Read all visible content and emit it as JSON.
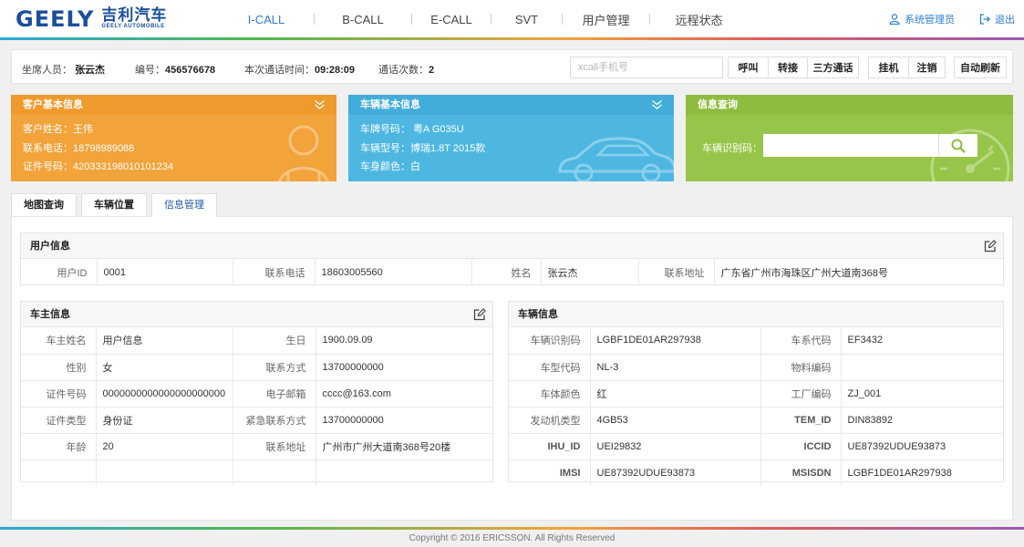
{
  "logo": {
    "brand": "GEELY",
    "cn": "吉利汽车",
    "sub": "GEELY AUTOMOBILE"
  },
  "nav": [
    "I-CALL",
    "B-CALL",
    "E-CALL",
    "SVT",
    "用户管理",
    "远程状态"
  ],
  "user": {
    "name": "系统管理员",
    "logout": "退出"
  },
  "infobar": {
    "agent_label": "坐席人员：",
    "agent": "张云杰",
    "id_label": "编号：",
    "id": "456576678",
    "time_label": "本次通话时间：",
    "time": "09:28:09",
    "count_label": "通话次数：",
    "count": "2",
    "xcall_placeholder": "xcall手机号",
    "buttons_a": [
      "呼叫",
      "转接",
      "三方通话"
    ],
    "buttons_b": [
      "挂机",
      "注销"
    ],
    "refresh": "自动刷新"
  },
  "customer": {
    "title": "客户基本信息",
    "name": "客户姓名：王伟",
    "phone": "联系电话：18798989088",
    "idno": "证件号码：420333198010101234"
  },
  "vehicle": {
    "title": "车辆基本信息",
    "plate": "车牌号码： 粤A G035U",
    "model": "车辆型号：博瑞1.8T 2015款",
    "color": "车身颜色：白"
  },
  "query": {
    "title": "信息查询",
    "vin_label": "车辆识别码："
  },
  "tabs": [
    "地图查询",
    "车辆位置",
    "信息管理"
  ],
  "user_info": {
    "title": "用户信息",
    "cells": [
      "用户ID",
      "0001",
      "联系电话",
      "18603005560",
      "姓名",
      "张云杰",
      "联系地址",
      "广东省广州市海珠区广州大道南368号"
    ]
  },
  "owner_info": {
    "title": "车主信息",
    "rows": [
      [
        "车主姓名",
        "用户信息",
        "生日",
        "1900.09.09"
      ],
      [
        "性别",
        "女",
        "联系方式",
        "13700000000"
      ],
      [
        "证件号码",
        "0000000000000000000000",
        "电子邮箱",
        "cccc@163.com"
      ],
      [
        "证件类型",
        "身份证",
        "紧急联系方式",
        "13700000000"
      ],
      [
        "年龄",
        "20",
        "联系地址",
        "广州市广州大道南368号20楼"
      ],
      [
        "",
        "",
        "",
        ""
      ]
    ]
  },
  "car_info": {
    "title": "车辆信息",
    "rows": [
      [
        "车辆识别码",
        "LGBF1DE01AR297938",
        "车系代码",
        "EF3432"
      ],
      [
        "车型代码",
        "NL-3",
        "物料编码",
        ""
      ],
      [
        "车体颜色",
        "红",
        "工厂编码",
        "ZJ_001"
      ],
      [
        "发动机类型",
        "4GB53",
        "TEM_ID",
        "DIN83892"
      ],
      [
        "IHU_ID",
        "UEI29832",
        "ICCID",
        "UE87392UDUE93873"
      ],
      [
        "IMSI",
        "UE87392UDUE93873",
        "MSISDN",
        "LGBF1DE01AR297938"
      ]
    ]
  },
  "footer": "Copyright © 2016 ERICSSON. All Rights Reserved",
  "colors": {
    "orange": "#f2a33a",
    "blue": "#4db7e2",
    "green": "#97c549",
    "accent": "#2a7fd4"
  },
  "icons": [
    "user-icon",
    "logout-icon",
    "chevron-down-icon",
    "search-icon",
    "edit-icon",
    "person-silhouette-icon",
    "car-silhouette-icon",
    "speedometer-icon"
  ]
}
